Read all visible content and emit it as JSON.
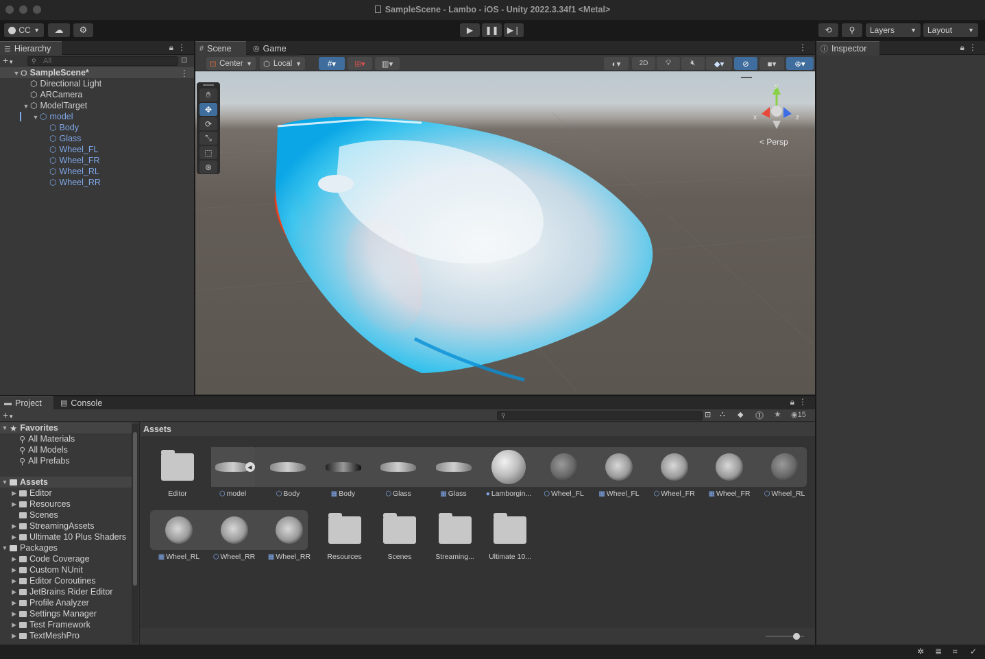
{
  "window": {
    "title": "SampleScene - Lambo - iOS - Unity 2022.3.34f1 <Metal>"
  },
  "toolbar": {
    "account": "CC",
    "layers_label": "Layers",
    "layout_label": "Layout"
  },
  "hierarchy": {
    "tab_label": "Hierarchy",
    "search_placeholder": "All",
    "items": [
      {
        "label": "SampleScene*",
        "indent": 0,
        "type": "scene"
      },
      {
        "label": "Directional Light",
        "indent": 1,
        "type": "object"
      },
      {
        "label": "ARCamera",
        "indent": 1,
        "type": "object"
      },
      {
        "label": "ModelTarget",
        "indent": 1,
        "type": "object"
      },
      {
        "label": "model",
        "indent": 2,
        "type": "prefab"
      },
      {
        "label": "Body",
        "indent": 3,
        "type": "prefab-child"
      },
      {
        "label": "Glass",
        "indent": 3,
        "type": "prefab-child"
      },
      {
        "label": "Wheel_FL",
        "indent": 3,
        "type": "prefab-child"
      },
      {
        "label": "Wheel_FR",
        "indent": 3,
        "type": "prefab-child"
      },
      {
        "label": "Wheel_RL",
        "indent": 3,
        "type": "prefab-child"
      },
      {
        "label": "Wheel_RR",
        "indent": 3,
        "type": "prefab-child"
      }
    ]
  },
  "scene": {
    "tabs": [
      {
        "label": "Scene"
      },
      {
        "label": "Game"
      }
    ],
    "pivot_label": "Center",
    "space_label": "Local",
    "mode_2d": "2D",
    "projection_label": "Persp",
    "gizmo_axes": {
      "x": "x",
      "y": "y",
      "z": "z"
    }
  },
  "inspector": {
    "tab_label": "Inspector"
  },
  "project": {
    "tabs": [
      {
        "label": "Project"
      },
      {
        "label": "Console"
      }
    ],
    "hidden_count": "15",
    "favorites": {
      "title": "Favorites",
      "items": [
        "All Materials",
        "All Models",
        "All Prefabs"
      ]
    },
    "assets_section": {
      "title": "Assets",
      "items": [
        "Editor",
        "Resources",
        "Scenes",
        "StreamingAssets",
        "Ultimate 10 Plus Shaders"
      ]
    },
    "packages_section": {
      "title": "Packages",
      "items": [
        "Code Coverage",
        "Custom NUnit",
        "Editor Coroutines",
        "JetBrains Rider Editor",
        "Profile Analyzer",
        "Settings Manager",
        "Test Framework",
        "TextMeshPro"
      ]
    },
    "grid_header": "Assets",
    "assets_row1": [
      {
        "label": "Editor",
        "kind": "folder"
      },
      {
        "label": "model",
        "kind": "model"
      },
      {
        "label": "Body",
        "kind": "model"
      },
      {
        "label": "Body",
        "kind": "mesh"
      },
      {
        "label": "Glass",
        "kind": "model"
      },
      {
        "label": "Glass",
        "kind": "mesh"
      },
      {
        "label": "Lamborgin...",
        "kind": "material"
      },
      {
        "label": "Wheel_FL",
        "kind": "model"
      },
      {
        "label": "Wheel_FL",
        "kind": "mesh"
      },
      {
        "label": "Wheel_FR",
        "kind": "model"
      },
      {
        "label": "Wheel_FR",
        "kind": "mesh"
      },
      {
        "label": "Wheel_RL",
        "kind": "model"
      }
    ],
    "assets_row2": [
      {
        "label": "Wheel_RL",
        "kind": "mesh"
      },
      {
        "label": "Wheel_RR",
        "kind": "model"
      },
      {
        "label": "Wheel_RR",
        "kind": "mesh"
      },
      {
        "label": "Resources",
        "kind": "folder"
      },
      {
        "label": "Scenes",
        "kind": "folder"
      },
      {
        "label": "Streaming...",
        "kind": "folder"
      },
      {
        "label": "Ultimate 10...",
        "kind": "folder"
      }
    ],
    "thumbnail_size": 0.8
  },
  "colors": {
    "accent": "#3f6e9e",
    "prefab_blue": "#7fa8ea",
    "panel_bg": "#383838"
  }
}
